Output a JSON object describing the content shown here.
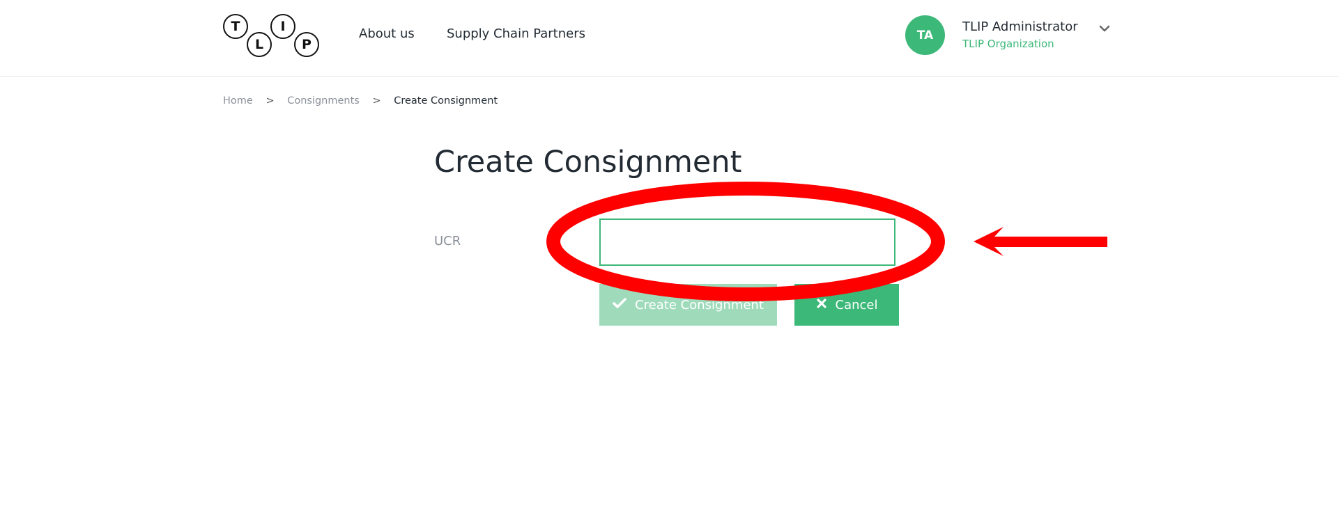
{
  "header": {
    "logo_letters": [
      "T",
      "L",
      "I",
      "P"
    ],
    "nav": [
      {
        "label": "About us"
      },
      {
        "label": "Supply Chain Partners"
      }
    ],
    "user": {
      "initials": "TA",
      "name": "TLIP Administrator",
      "organization": "TLIP Organization"
    }
  },
  "breadcrumb": {
    "items": [
      "Home",
      "Consignments",
      "Create Consignment"
    ],
    "separator": ">"
  },
  "page": {
    "title": "Create Consignment"
  },
  "form": {
    "ucr_label": "UCR",
    "ucr_value": "",
    "create_label": "Create Consignment",
    "cancel_label": "Cancel"
  },
  "colors": {
    "accent": "#3cb878",
    "accent_disabled": "#9fdbbb",
    "annotation": "#ff0000"
  }
}
